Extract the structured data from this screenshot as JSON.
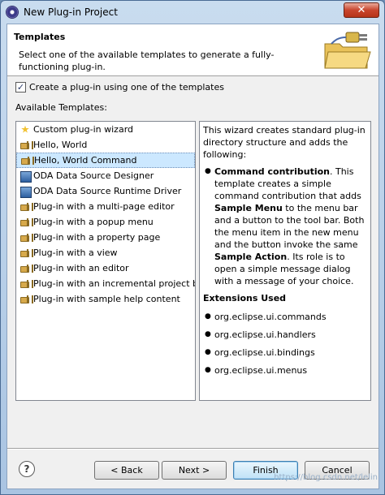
{
  "window": {
    "title": "New Plug-in Project",
    "close_glyph": "✕"
  },
  "header": {
    "title": "Templates",
    "description": "Select one of the available templates to generate a fully-functioning plug-in."
  },
  "checkbox": {
    "label": "Create a plug-in using one of the templates",
    "checked_glyph": "✓"
  },
  "available_label": "Available Templates:",
  "templates": [
    {
      "label": "Custom plug-in wizard",
      "icon": "wizard-icon"
    },
    {
      "label": "Hello, World",
      "icon": "plugin-icon"
    },
    {
      "label": "Hello, World Command",
      "icon": "plugin-icon",
      "selected": true
    },
    {
      "label": "ODA Data Source Designer",
      "icon": "oda-icon"
    },
    {
      "label": "ODA Data Source Runtime Driver",
      "icon": "oda-icon"
    },
    {
      "label": "Plug-in with a multi-page editor",
      "icon": "plugin-icon"
    },
    {
      "label": "Plug-in with a popup menu",
      "icon": "plugin-icon"
    },
    {
      "label": "Plug-in with a property page",
      "icon": "plugin-icon"
    },
    {
      "label": "Plug-in with a view",
      "icon": "plugin-icon"
    },
    {
      "label": "Plug-in with an editor",
      "icon": "plugin-icon"
    },
    {
      "label": "Plug-in with an incremental project bu",
      "icon": "plugin-icon"
    },
    {
      "label": "Plug-in with sample help content",
      "icon": "plugin-icon"
    }
  ],
  "details": {
    "intro": "This wizard creates standard plug-in directory structure and adds the following:",
    "bullet_title": "Command contribution",
    "bullet_text_1": ". This template creates a simple command contribution that adds ",
    "bullet_bold_1": "Sample Menu",
    "bullet_text_2": " to the menu bar and a button to the tool bar. Both the menu item in the new menu and the button invoke the same ",
    "bullet_bold_2": "Sample Action",
    "bullet_text_3": ". Its role is to open a simple message dialog with a message of your choice.",
    "extensions_heading": "Extensions Used",
    "extensions": [
      "org.eclipse.ui.commands",
      "org.eclipse.ui.handlers",
      "org.eclipse.ui.bindings",
      "org.eclipse.ui.menus"
    ]
  },
  "buttons": {
    "help": "?",
    "back": "< Back",
    "next": "Next >",
    "finish": "Finish",
    "cancel": "Cancel"
  },
  "watermark": "https://blog.csdn.net/lelin"
}
